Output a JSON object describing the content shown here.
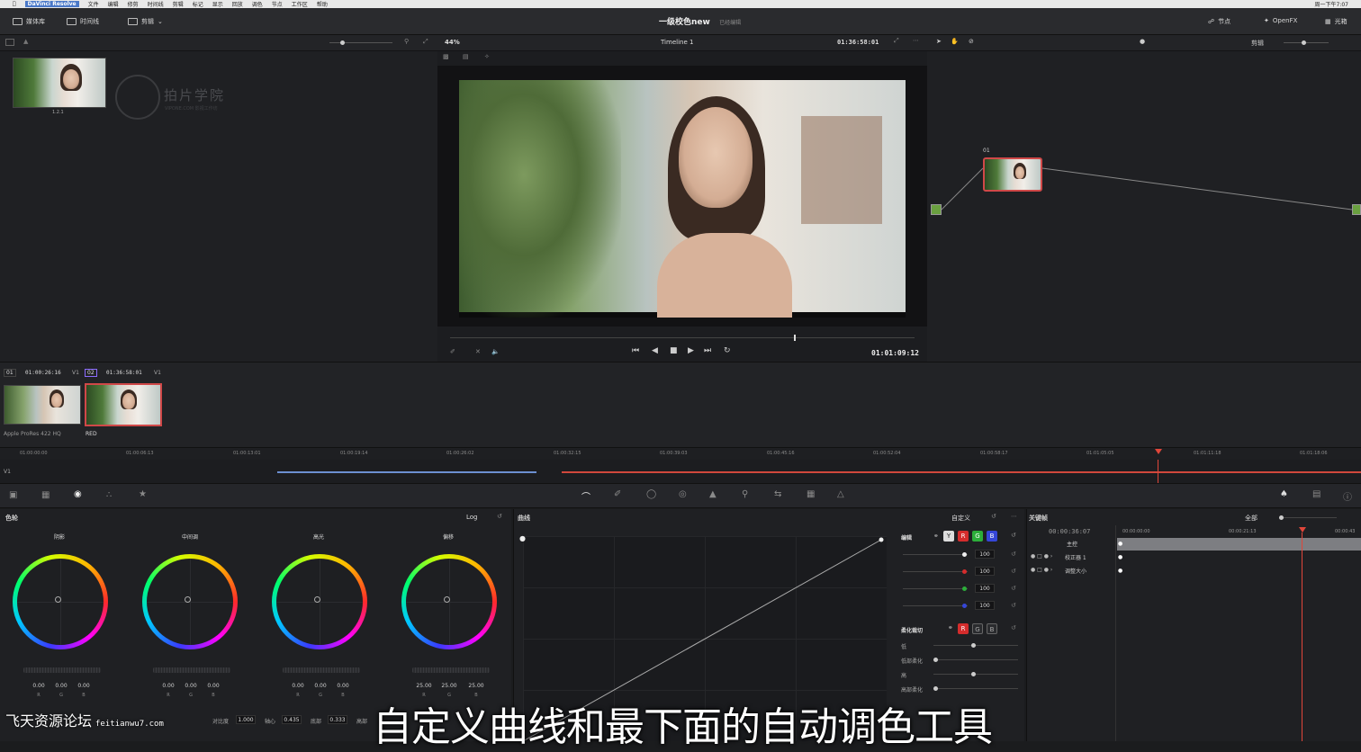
{
  "menubar": {
    "app": "DaVinci Resolve",
    "items": [
      "文件",
      "编辑",
      "修剪",
      "时间线",
      "剪辑",
      "标记",
      "显示",
      "回放",
      "调色",
      "节点",
      "工作区",
      "帮助"
    ],
    "clock": "周一下午7:07"
  },
  "toolbar": {
    "media_pool": "媒体库",
    "timeline": "时间线",
    "clips": "剪辑",
    "project_title": "一级校色new",
    "project_status": "已经编辑",
    "nodes": "节点",
    "openfx": "OpenFX",
    "lightbox": "光箱"
  },
  "viewer_bar": {
    "zoom": "44%",
    "timeline_name": "Timeline 1",
    "timecode": "01:36:58:01",
    "mode": "剪辑"
  },
  "gallery": {
    "still_label": "1.2.1",
    "logo_text": "拍片学院",
    "logo_sub": "VIPONE.COM 影视工作坊"
  },
  "viewer": {
    "playhead_timecode": "01:01:09:12"
  },
  "node_editor": {
    "node_label": "01"
  },
  "clips_strip": {
    "clip1": {
      "index": "01",
      "timecode": "01:00:26:16",
      "track": "V1",
      "codec": "Apple ProRes 422 HQ"
    },
    "clip2": {
      "index": "02",
      "timecode": "01:36:58:01",
      "track": "V1",
      "codec": "RED"
    }
  },
  "ruler": {
    "track": "V1",
    "ticks": [
      "01:00:00:00",
      "01:00:06:13",
      "01:00:13:01",
      "01:00:19:14",
      "01:00:26:02",
      "01:00:32:15",
      "01:00:39:03",
      "01:00:45:16",
      "01:00:52:04",
      "01:00:58:17",
      "01:01:05:05",
      "01:01:11:18",
      "01:01:18:06"
    ]
  },
  "color_wheels": {
    "title": "色轮",
    "mode": "Log",
    "wheels": [
      {
        "label": "阴影",
        "values": [
          "0.00",
          "0.00",
          "0.00"
        ]
      },
      {
        "label": "中间调",
        "values": [
          "0.00",
          "0.00",
          "0.00"
        ]
      },
      {
        "label": "高光",
        "values": [
          "0.00",
          "0.00",
          "0.00"
        ]
      },
      {
        "label": "偏移",
        "values": [
          "25.00",
          "25.00",
          "25.00"
        ]
      }
    ],
    "channel_letters": [
      "R",
      "G",
      "B"
    ],
    "contrast_label": "对比度",
    "contrast": "1.000",
    "pivot_label": "轴心",
    "pivot": "0.435",
    "shadows_label": "底部",
    "shadows": "0.333",
    "highs_label": "高部"
  },
  "curves": {
    "title": "曲线",
    "mode": "自定义",
    "edit_label": "编辑",
    "channels": [
      "Y",
      "R",
      "G",
      "B"
    ],
    "intensity": [
      "100",
      "100",
      "100",
      "100"
    ],
    "soft_clip_label": "柔化裁切",
    "soft_rows": [
      "低",
      "低部柔化",
      "高",
      "高部柔化"
    ]
  },
  "keyframes": {
    "title": "关键帧",
    "scope": "全部",
    "timecode": "00:00:36:07",
    "ticks": [
      "00:00:00:00",
      "00:00:21:13",
      "00:00:43"
    ],
    "tracks": [
      "主控",
      "校正器 1",
      "调整大小"
    ]
  },
  "subtitle": "自定义曲线和最下面的自动调色工具",
  "watermark": {
    "text": "飞天资源论坛",
    "url": "feitianwu7.com"
  },
  "colors": {
    "accent_red": "#e0463a",
    "accent_blue": "#4a78c8",
    "panel": "#1f2023"
  }
}
